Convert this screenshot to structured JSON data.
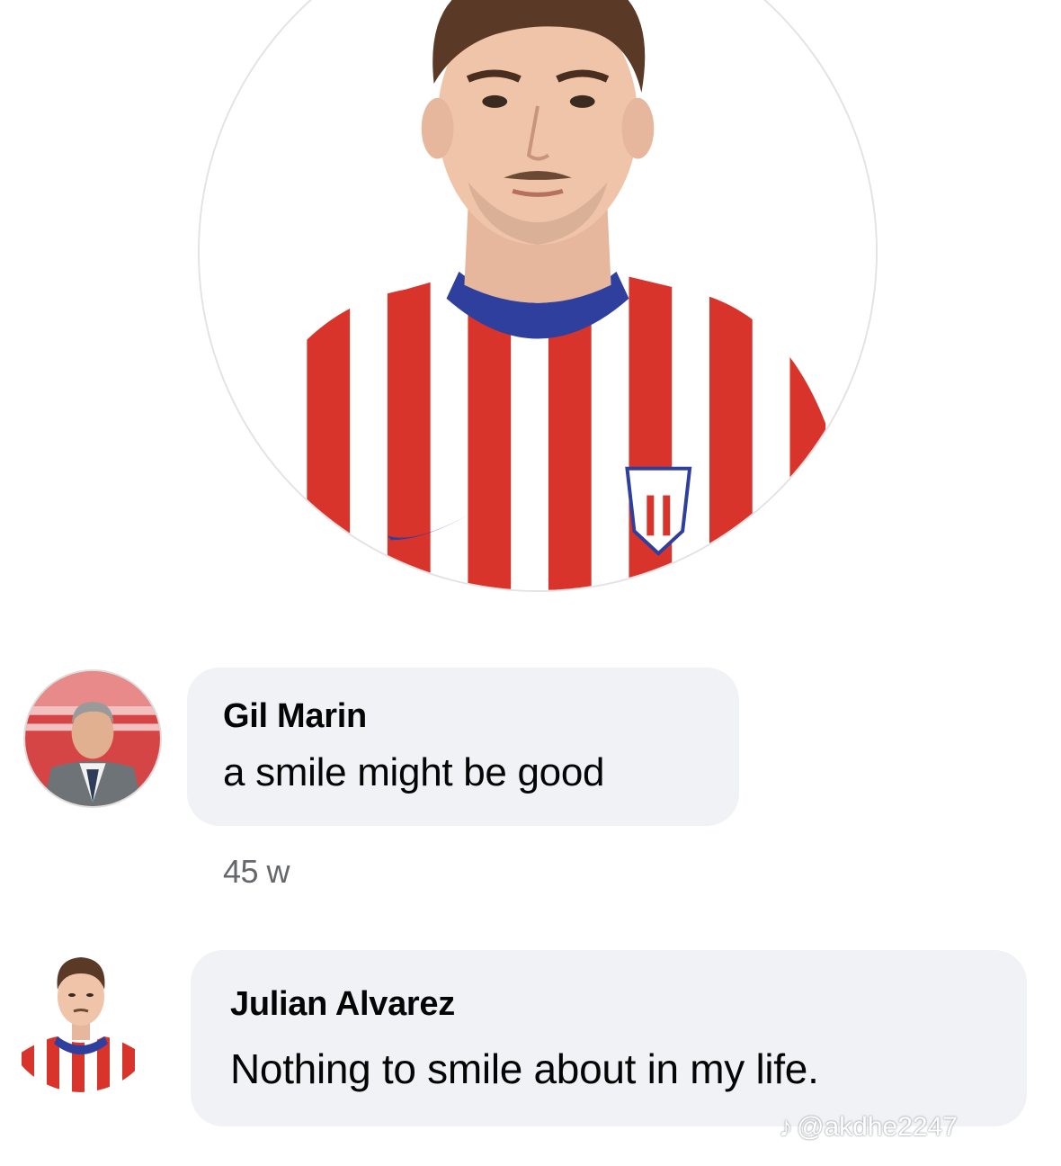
{
  "profile": {
    "photo_subject": "player-in-red-white-striped-jersey"
  },
  "comments": [
    {
      "author": "Gil Marin",
      "text": "a smile might be good",
      "time": "45 w",
      "avatar": "man-in-suit-avatar"
    },
    {
      "author": "Julian Alvarez",
      "text": "Nothing to smile about in my life.",
      "avatar": "player-avatar"
    }
  ],
  "watermark": {
    "icon": "tiktok-note-icon",
    "handle": "@akdhe2247"
  },
  "colors": {
    "bubble": "#f0f2f5",
    "jersey_red": "#d9342b",
    "jersey_navy": "#2f3f9e",
    "timestamp": "#65676b"
  }
}
